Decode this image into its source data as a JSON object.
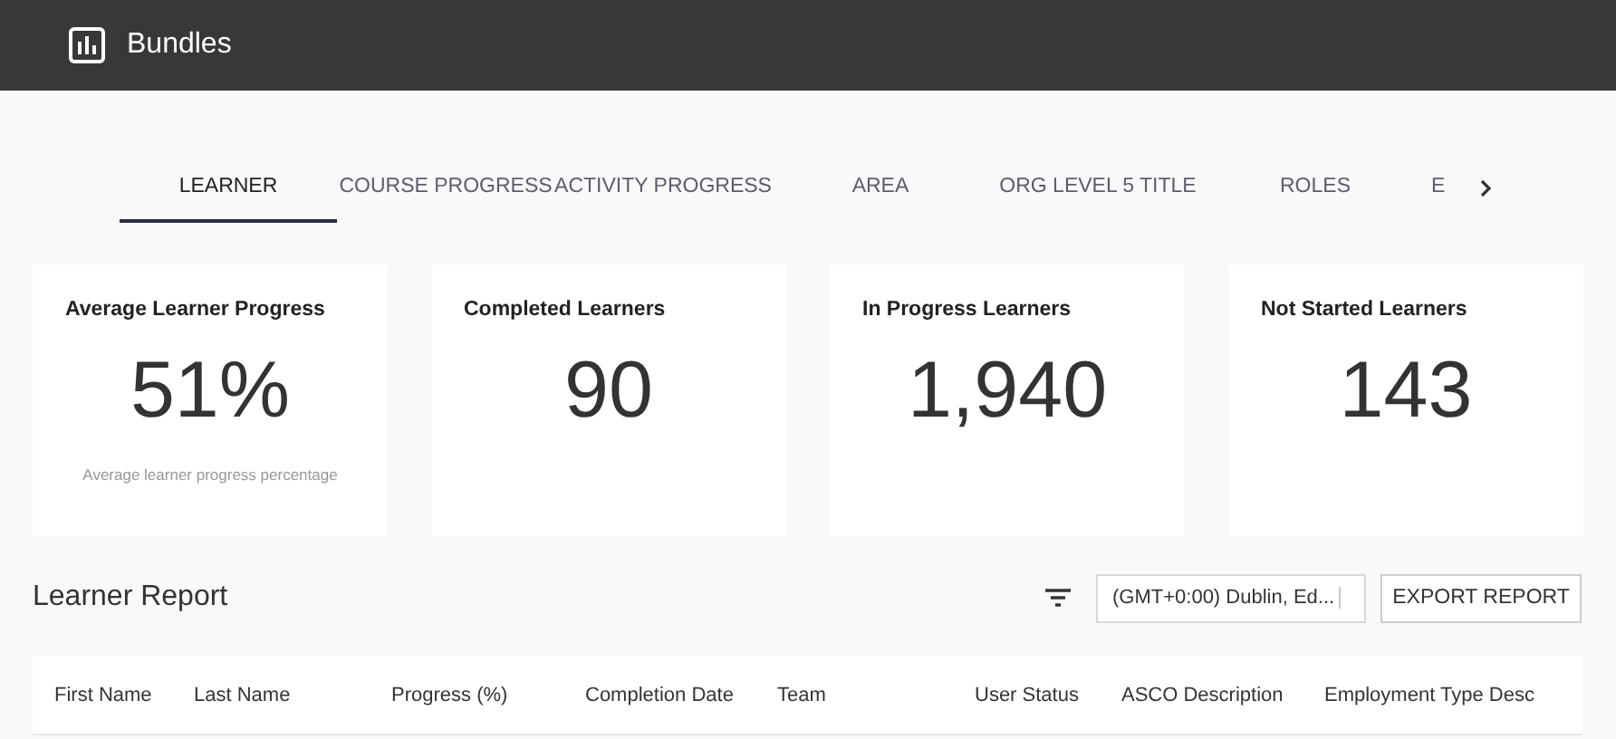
{
  "app_bar": {
    "title": "Bundles"
  },
  "tabs": [
    {
      "label": "LEARNER",
      "selected": true
    },
    {
      "label": "COURSE PROGRESS",
      "selected": false
    },
    {
      "label": "ACTIVITY PROGRESS",
      "selected": false
    },
    {
      "label": "AREA",
      "selected": false
    },
    {
      "label": "ORG LEVEL 5 TITLE",
      "selected": false
    },
    {
      "label": "ROLES",
      "selected": false
    },
    {
      "label": "E",
      "selected": false
    }
  ],
  "cards": [
    {
      "title": "Average Learner Progress",
      "value": "51%",
      "caption": "Average learner progress percentage"
    },
    {
      "title": "Completed Learners",
      "value": "90"
    },
    {
      "title": "In Progress Learners",
      "value": "1,940"
    },
    {
      "title": "Not Started Learners",
      "value": "143"
    }
  ],
  "report": {
    "title": "Learner Report",
    "timezone": "(GMT+0:00) Dublin, Ed...",
    "export_button": "EXPORT REPORT",
    "columns": [
      "First Name",
      "Last Name",
      "Progress (%)",
      "Completion Date",
      "Team",
      "User Status",
      "ASCO Description",
      "Employment Type Desc"
    ]
  }
}
